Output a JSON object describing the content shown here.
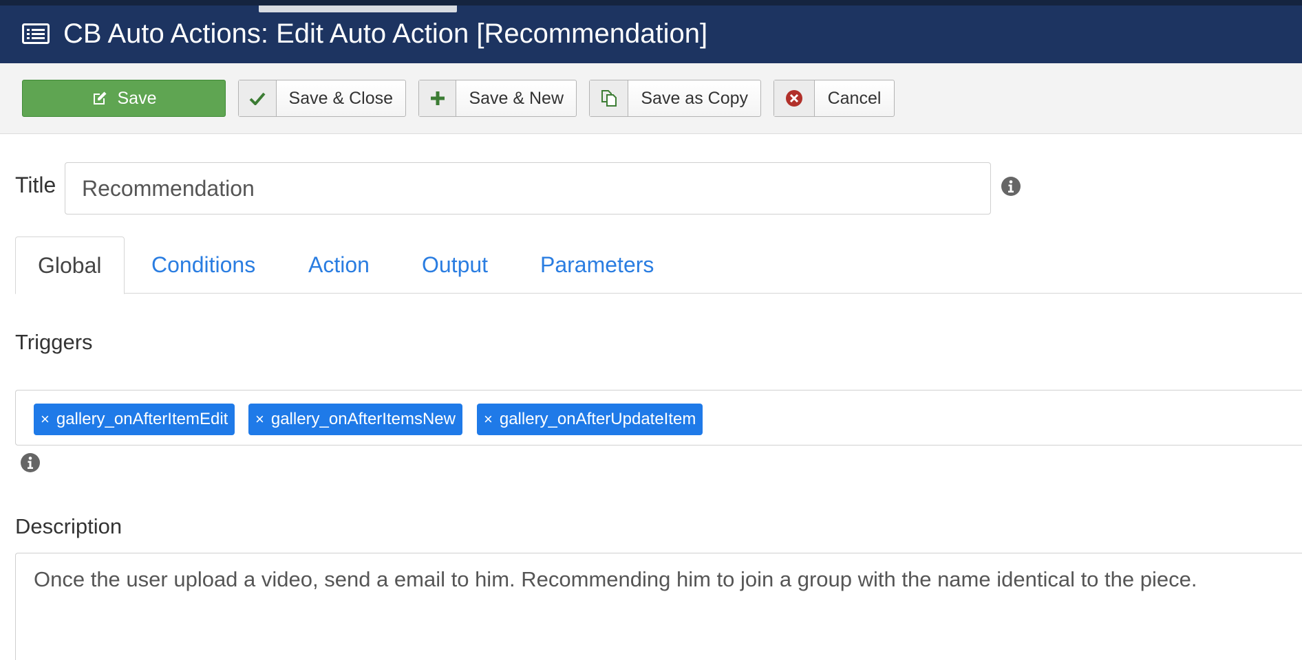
{
  "header": {
    "title": "CB Auto Actions: Edit Auto Action [Recommendation]",
    "icon": "list-icon",
    "background": "#1d3461"
  },
  "toolbar": {
    "save_label": "Save",
    "save_close_label": "Save & Close",
    "save_new_label": "Save & New",
    "save_copy_label": "Save as Copy",
    "cancel_label": "Cancel",
    "save_color": "#5fa552"
  },
  "form": {
    "title_label": "Title",
    "title_value": "Recommendation"
  },
  "tabs": [
    {
      "label": "Global",
      "active": true
    },
    {
      "label": "Conditions",
      "active": false
    },
    {
      "label": "Action",
      "active": false
    },
    {
      "label": "Output",
      "active": false
    },
    {
      "label": "Parameters",
      "active": false
    }
  ],
  "triggers": {
    "label": "Triggers",
    "remove_symbol": "×",
    "tags": [
      "gallery_onAfterItemEdit",
      "gallery_onAfterItemsNew",
      "gallery_onAfterUpdateItem"
    ],
    "tag_color": "#1f7ae8"
  },
  "description": {
    "label": "Description",
    "value": "Once the user upload a video, send a email to him. Recommending him to join a group with the name identical to the piece."
  }
}
